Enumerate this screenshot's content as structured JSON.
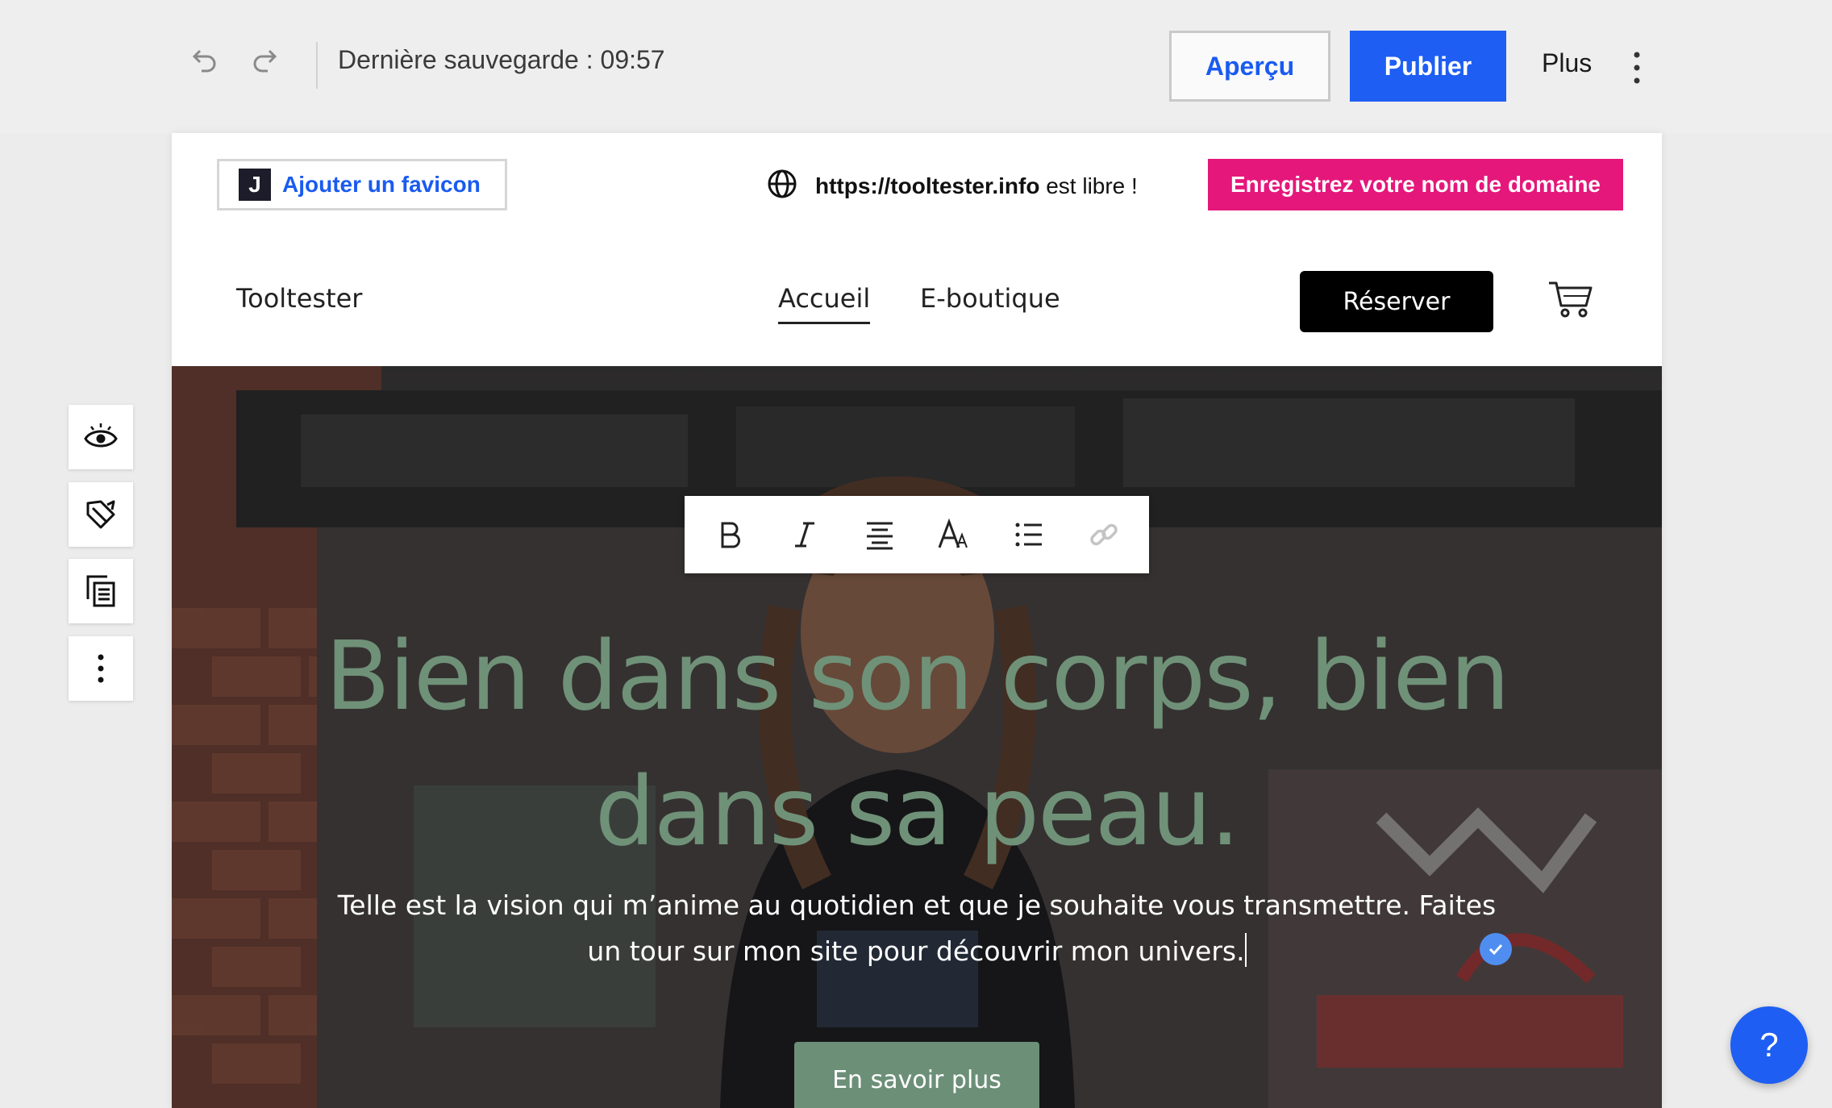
{
  "editor": {
    "last_save": "Dernière sauvegarde : 09:57",
    "preview_label": "Aperçu",
    "publish_label": "Publier",
    "more_label": "Plus",
    "accent_color": "#1e5ef3"
  },
  "side_toolbar": {
    "items": [
      "eye-icon",
      "paint-icon",
      "pages-icon",
      "more-vertical-icon"
    ]
  },
  "domain_bar": {
    "favicon_logo": "J",
    "favicon_label": "Ajouter un favicon",
    "url": "https://tooltester.info",
    "status": " est libre !",
    "register_label": "Enregistrez votre nom de domaine",
    "register_color": "#e5177b"
  },
  "site_nav": {
    "brand": "Tooltester",
    "items": [
      "Accueil",
      "E-boutique"
    ],
    "active": "Accueil",
    "book_label": "Réserver"
  },
  "format_toolbar": {
    "items": [
      "bold-icon",
      "italic-icon",
      "align-center-icon",
      "text-style-icon",
      "list-icon",
      "link-icon"
    ]
  },
  "hero": {
    "title": "Bien dans son corps, bien dans sa peau.",
    "text": "Telle est la vision qui m’anime au quotidien et que je souhaite vous transmettre. Faites un tour sur mon site pour découvrir mon univers.",
    "button_label": "En savoir plus",
    "title_color": "#6f9178"
  },
  "help": {
    "label": "?"
  }
}
